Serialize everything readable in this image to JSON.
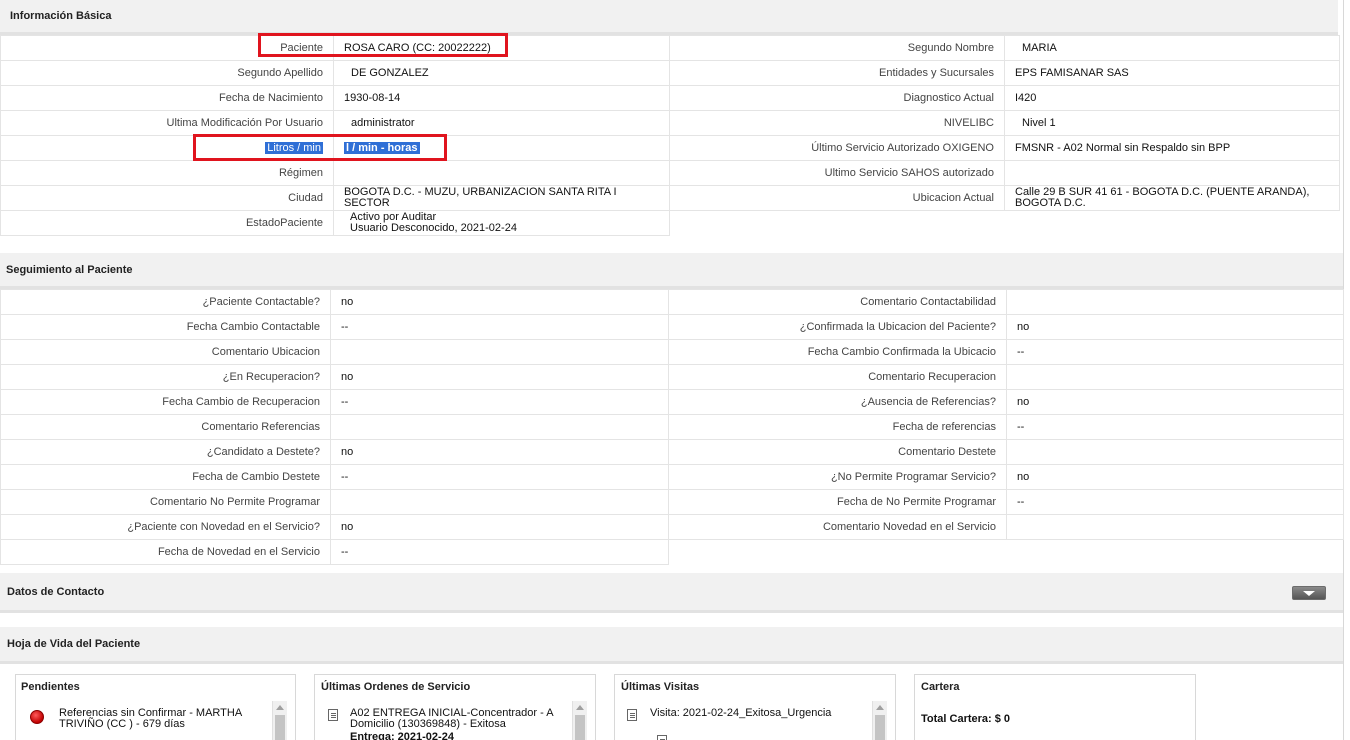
{
  "sections": {
    "basic": "Información Básica",
    "tracking": "Seguimiento al Paciente",
    "contact": "Datos de Contacto",
    "history": "Hoja de Vida del Paciente"
  },
  "basic_left": [
    {
      "label": "Paciente",
      "value": "ROSA CARO (CC: 20022222)"
    },
    {
      "label": "Segundo Apellido",
      "value": "DE GONZALEZ"
    },
    {
      "label": "Fecha de Nacimiento",
      "value": "1930-08-14"
    },
    {
      "label": "Ultima Modificación Por Usuario",
      "value": "administrator"
    },
    {
      "label": "Litros / min",
      "value": "l / min - horas"
    },
    {
      "label": "Régimen",
      "value": ""
    },
    {
      "label": "Ciudad",
      "value": "BOGOTA D.C. - MUZU, URBANIZACION SANTA RITA I SECTOR"
    },
    {
      "label": "EstadoPaciente",
      "value": "Activo por Auditar",
      "value2": "Usuario Desconocido, 2021-02-24"
    }
  ],
  "basic_right": [
    {
      "label": "Segundo Nombre",
      "value": "MARIA"
    },
    {
      "label": "Entidades y Sucursales",
      "value": "EPS FAMISANAR SAS"
    },
    {
      "label": "Diagnostico Actual",
      "value": "I420"
    },
    {
      "label": "NIVELIBC",
      "value": "Nivel 1"
    },
    {
      "label": "Último Servicio Autorizado OXIGENO",
      "value": "FMSNR - A02 Normal sin Respaldo sin BPP"
    },
    {
      "label": "Ultimo Servicio SAHOS autorizado",
      "value": ""
    },
    {
      "label": "Ubicacion Actual",
      "value": "Calle 29 B SUR 41 61 - BOGOTA D.C. (PUENTE ARANDA), BOGOTA D.C."
    }
  ],
  "tracking_left": [
    {
      "label": "¿Paciente Contactable?",
      "value": "no"
    },
    {
      "label": "Fecha Cambio Contactable",
      "value": "--"
    },
    {
      "label": "Comentario Ubicacion",
      "value": ""
    },
    {
      "label": "¿En Recuperacion?",
      "value": "no"
    },
    {
      "label": "Fecha Cambio de Recuperacion",
      "value": "--"
    },
    {
      "label": "Comentario Referencias",
      "value": ""
    },
    {
      "label": "¿Candidato a Destete?",
      "value": "no"
    },
    {
      "label": "Fecha de Cambio Destete",
      "value": "--"
    },
    {
      "label": "Comentario No Permite Programar",
      "value": ""
    },
    {
      "label": "¿Paciente con Novedad en el Servicio?",
      "value": "no"
    },
    {
      "label": "Fecha de Novedad en el Servicio",
      "value": "--"
    }
  ],
  "tracking_right": [
    {
      "label": "Comentario Contactabilidad",
      "value": ""
    },
    {
      "label": "¿Confirmada la Ubicacion del Paciente?",
      "value": "no"
    },
    {
      "label": "Fecha Cambio Confirmada la Ubicacio",
      "value": "--"
    },
    {
      "label": "Comentario Recuperacion",
      "value": ""
    },
    {
      "label": "¿Ausencia de Referencias?",
      "value": "no"
    },
    {
      "label": "Fecha de referencias",
      "value": "--"
    },
    {
      "label": "Comentario Destete",
      "value": ""
    },
    {
      "label": "¿No Permite Programar Servicio?",
      "value": "no"
    },
    {
      "label": "Fecha de No Permite Programar",
      "value": "--"
    },
    {
      "label": "Comentario Novedad en el Servicio",
      "value": ""
    }
  ],
  "panels": {
    "pending": {
      "title": "Pendientes",
      "item": "Referencias sin Confirmar - MARTHA TRIVIÑO (CC ) - 679 días"
    },
    "orders": {
      "title": "Últimas Ordenes de Servicio",
      "item": "A02 ENTREGA INICIAL-Concentrador - A Domicilio (130369848) - Exitosa",
      "item2": "Entrega: 2021-02-24"
    },
    "visits": {
      "title": "Últimas Visitas",
      "item": "Visita: 2021-02-24_Exitosa_Urgencia"
    },
    "wallet": {
      "title": "Cartera",
      "item": "Total Cartera: $ 0"
    }
  },
  "colors": {
    "highlight": "#2f6fd6",
    "annotation": "#e0141e"
  },
  "icons": {
    "collapse": "chevron-down-icon",
    "pending": "red-dot-icon",
    "document": "document-icon"
  }
}
